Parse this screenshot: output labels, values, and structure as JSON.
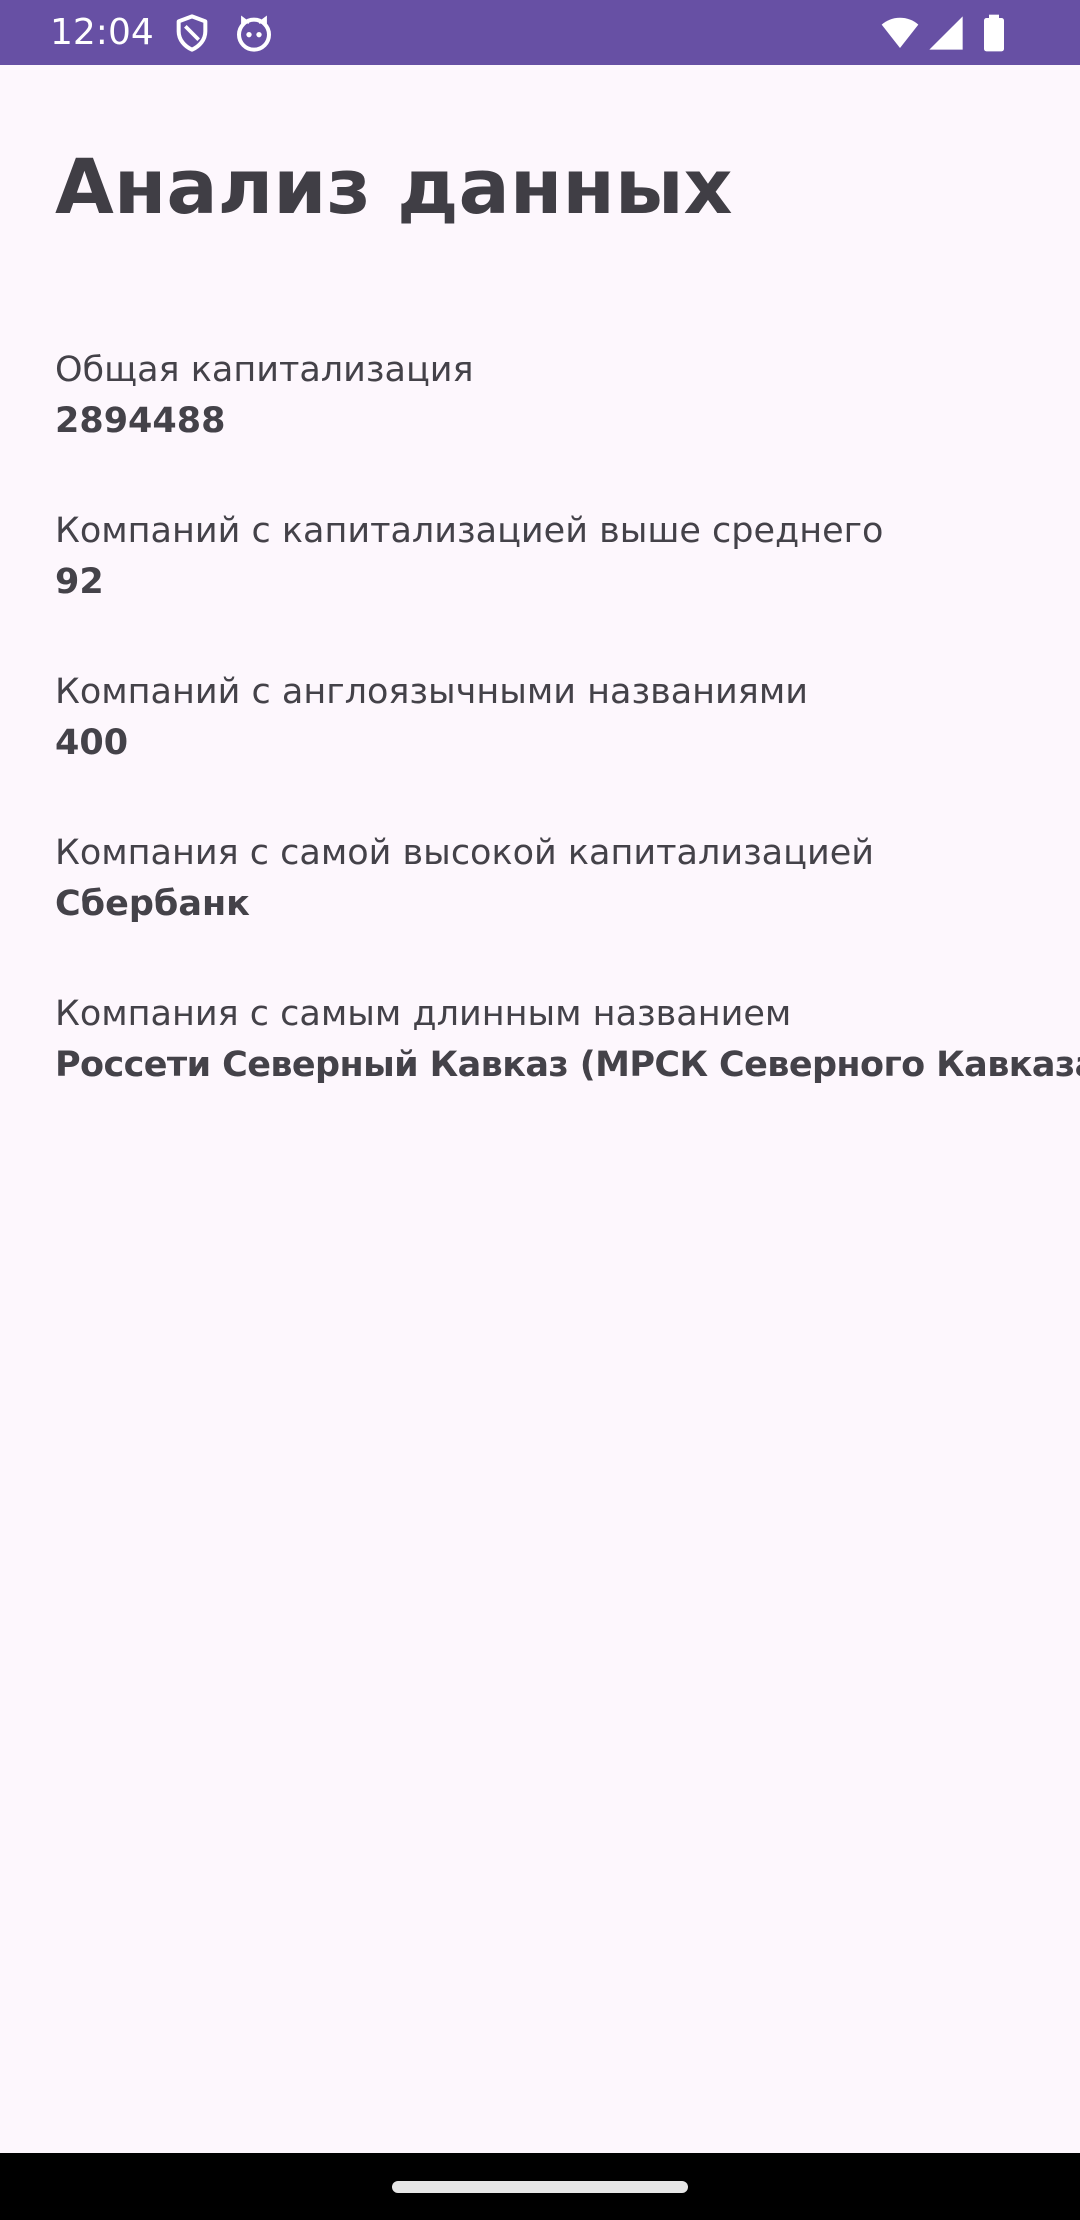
{
  "status_bar": {
    "time": "12:04",
    "icons_left": [
      "shield-icon",
      "cat-icon"
    ],
    "icons_right": [
      "wifi-icon",
      "signal-icon",
      "battery-icon"
    ],
    "color": "#6750a4"
  },
  "page": {
    "title": "Анализ данных",
    "background": "#fdf7fd"
  },
  "stats": [
    {
      "label": "Общая капитализация",
      "value": "2894488"
    },
    {
      "label": "Компаний с капитализацией выше среднего",
      "value": "92"
    },
    {
      "label": "Компаний с англоязычными названиями",
      "value": "400"
    },
    {
      "label": "Компания с самой высокой капитализацией",
      "value": "Сбербанк"
    },
    {
      "label": "Компания с самым длинным названием",
      "value": "Россети Северный Кавказ (МРСК Северного Кавказа)"
    }
  ]
}
